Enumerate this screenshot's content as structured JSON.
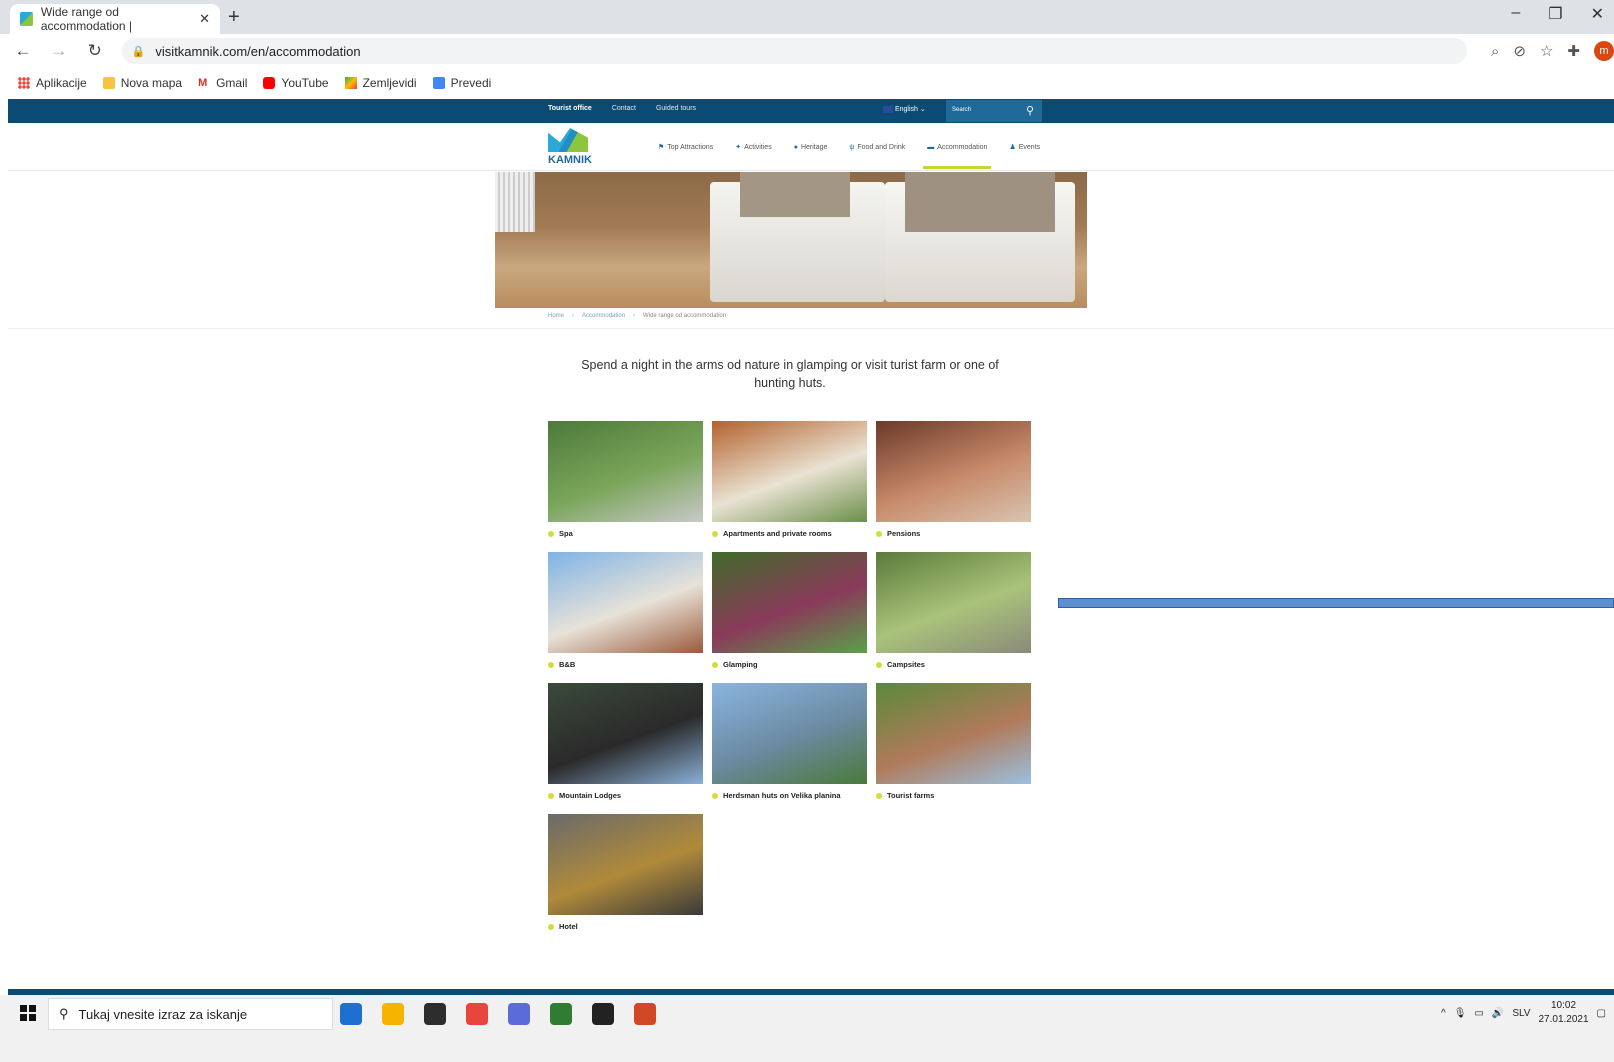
{
  "browser": {
    "tab_title": "Wide range od accommodation |",
    "tab_close": "✕",
    "new_tab": "+",
    "url": "visitkamnik.com/en/accommodation",
    "window_controls": [
      "–",
      "❐",
      "✕"
    ],
    "avatar_letter": "m",
    "bookmarks": [
      {
        "label": "Aplikacije",
        "color": "#e8453c"
      },
      {
        "label": "Nova mapa",
        "color": "#f6c343"
      },
      {
        "label": "Gmail",
        "color": "#d93025"
      },
      {
        "label": "YouTube",
        "color": "#ff0000"
      },
      {
        "label": "Zemljevidi",
        "color": "#34a853"
      },
      {
        "label": "Prevedi",
        "color": "#4285f4"
      }
    ]
  },
  "site": {
    "topbar": {
      "links": [
        "Tourist office",
        "Contact",
        "Guided tours"
      ],
      "language": "English",
      "search_placeholder": "Search"
    },
    "logo_text": "KAMNIK",
    "nav": [
      {
        "label": "Top Attractions",
        "icon": "⚑"
      },
      {
        "label": "Activities",
        "icon": "✦"
      },
      {
        "label": "Heritage",
        "icon": "●"
      },
      {
        "label": "Food and Drink",
        "icon": "ψ"
      },
      {
        "label": "Accommodation",
        "icon": "▬"
      },
      {
        "label": "Events",
        "icon": "♟"
      }
    ],
    "active_nav": "Accommodation",
    "breadcrumb": [
      "Home",
      "Accommodation",
      "Wide range od accommodation"
    ],
    "intro": "Spend a night in the arms od nature in glamping or visit turist farm or one of hunting huts.",
    "categories": [
      {
        "label": "Spa",
        "colors": [
          "#4d7a3a",
          "#7aa55a",
          "#c9c9c9"
        ]
      },
      {
        "label": "Apartments and private rooms",
        "colors": [
          "#b4622e",
          "#e9e2d2",
          "#6b8f4a"
        ]
      },
      {
        "label": "Pensions",
        "colors": [
          "#6b3a2a",
          "#c78a6a",
          "#d9c4b0"
        ]
      },
      {
        "label": "B&B",
        "colors": [
          "#7fb3e6",
          "#e7e2d8",
          "#9a5a3a"
        ]
      },
      {
        "label": "Glamping",
        "colors": [
          "#3f6b2a",
          "#8a3a5a",
          "#5aa04a"
        ]
      },
      {
        "label": "Campsites",
        "colors": [
          "#5b7a3a",
          "#a9c37a",
          "#8a8a7a"
        ]
      },
      {
        "label": "Mountain Lodges",
        "colors": [
          "#3a4a3a",
          "#2a2a2a",
          "#8ab0d8"
        ]
      },
      {
        "label": "Herdsman huts on Velika planina",
        "colors": [
          "#8ab4e0",
          "#6a8aa0",
          "#4a7a3a"
        ]
      },
      {
        "label": "Tourist farms",
        "colors": [
          "#5a8a3a",
          "#b07a5a",
          "#9ac0e0"
        ]
      },
      {
        "label": "Hotel",
        "colors": [
          "#6a6a6a",
          "#b08a3a",
          "#3a3a3a"
        ]
      }
    ]
  },
  "taskbar": {
    "search_placeholder": "Tukaj vnesite izraz za iskanje",
    "apps": [
      "#1f6fd1",
      "#f4b400",
      "#2d2d2d",
      "#e8453c",
      "#5b6cd8",
      "#2e7d32",
      "#222222",
      "#d24726"
    ],
    "language": "SLV",
    "time": "10:02",
    "date": "27.01.2021"
  }
}
